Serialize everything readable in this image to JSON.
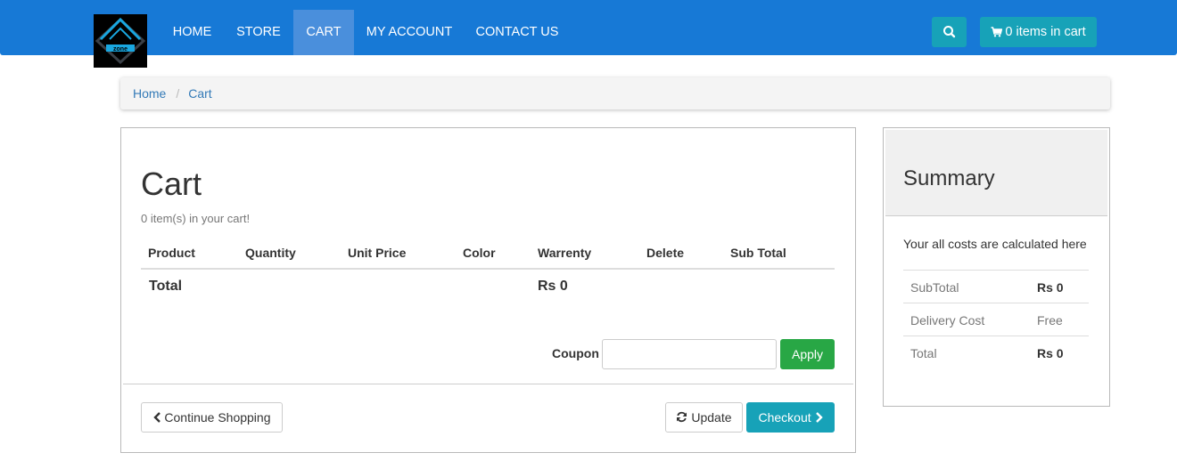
{
  "nav": {
    "logo_text": "zone",
    "items": [
      {
        "label": "HOME",
        "active": false
      },
      {
        "label": "STORE",
        "active": false
      },
      {
        "label": "CART",
        "active": true
      },
      {
        "label": "MY ACCOUNT",
        "active": false
      },
      {
        "label": "CONTACT US",
        "active": false
      }
    ],
    "search_icon": "search-icon",
    "cart_button_label": "0 items in cart",
    "cart_icon": "shopping-cart-icon"
  },
  "breadcrumb": {
    "home": "Home",
    "separator": "/",
    "current": "Cart"
  },
  "cart": {
    "title": "Cart",
    "count_text": "0 item(s) in your cart!",
    "columns": [
      "Product",
      "Quantity",
      "Unit Price",
      "Color",
      "Warrenty",
      "Delete",
      "Sub Total"
    ],
    "total_label": "Total",
    "total_value": "Rs 0",
    "coupon_label": "Coupon",
    "coupon_value": "",
    "apply_label": "Apply",
    "continue_label": "Continue Shopping",
    "update_label": "Update",
    "checkout_label": "Checkout"
  },
  "summary": {
    "title": "Summary",
    "description": "Your all costs are calculated here",
    "rows": [
      {
        "label": "SubTotal",
        "value": "Rs 0",
        "bold": true
      },
      {
        "label": "Delivery Cost",
        "value": "Free",
        "bold": false
      },
      {
        "label": "Total",
        "value": "Rs 0",
        "bold": true
      }
    ]
  },
  "colors": {
    "navbar": "#1779d6",
    "nav_active": "#4a8fdc",
    "info": "#17a2b8",
    "success": "#28a745",
    "link": "#337ab7"
  }
}
